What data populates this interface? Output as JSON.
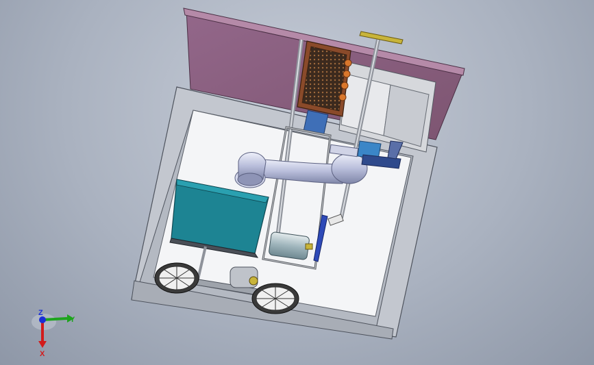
{
  "viewport": {
    "background_top": "#c6ccd7",
    "background_bottom": "#8e97a7"
  },
  "model": {
    "frame_color": "#c3c7cf",
    "hood_color": "#8a5f7e",
    "tank_color": "#1d8493",
    "duct_color": "#c9cde4",
    "filter_color": "#8a4a2a",
    "wheel_color": "#3a3a3a",
    "motor_color": "#6e9aa6",
    "panel_color": "#d6d8dc"
  },
  "triad": {
    "x_label": "X",
    "y_label": "Y",
    "z_label": "Z",
    "x_color": "#d21b1b",
    "y_color": "#1ea41e",
    "z_color": "#1a2fd6"
  }
}
